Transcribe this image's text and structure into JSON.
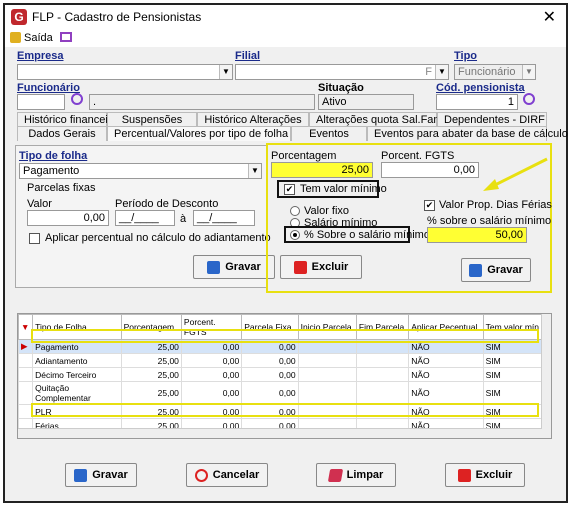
{
  "window": {
    "title": "FLP - Cadastro de Pensionistas",
    "logo": "G"
  },
  "menu": {
    "exit_label": "Saída"
  },
  "fields": {
    "empresa": {
      "label": "Empresa",
      "value": ""
    },
    "filial": {
      "label": "Filial",
      "value": "",
      "suffix": "F"
    },
    "tipo": {
      "label": "Tipo",
      "value": "Funcionário"
    },
    "funcionario": {
      "label": "Funcionário",
      "value": "",
      "name": "."
    },
    "situacao": {
      "label": "Situação",
      "value": "Ativo"
    },
    "cod_pensionista": {
      "label": "Cód. pensionista",
      "value": "1"
    }
  },
  "tabs_top": [
    "Histórico financeiro",
    "Suspensões",
    "Histórico Alterações",
    "Alterações quota Sal.Fam.",
    "Dependentes - DIRF"
  ],
  "tabs_bottom": [
    "Dados Gerais",
    "Percentual/Valores por tipo de folha",
    "Eventos",
    "Eventos para abater da base de cálculo"
  ],
  "left_panel": {
    "tipo_folha_label": "Tipo de folha",
    "tipo_folha_value": "Pagamento",
    "parcelas_label": "Parcelas fixas",
    "valor_label": "Valor",
    "valor_value": "0,00",
    "periodo_label": "Período de Desconto",
    "periodo_from": "__/____",
    "periodo_a": "à",
    "periodo_to": "__/____",
    "aplicar_label": "Aplicar percentual no cálculo do adiantamento",
    "gravar": "Gravar",
    "excluir": "Excluir"
  },
  "right_panel": {
    "porcentagem_label": "Porcentagem",
    "porcentagem_value": "25,00",
    "fgts_label": "Porcent. FGTS",
    "fgts_value": "0,00",
    "tem_valor_label": "Tem valor mínimo",
    "valor_fixo": "Valor fixo",
    "salario_minimo": "Salário mínimo",
    "sobre_salario": "% Sobre o salário mínimo",
    "prop_dias_label": "Valor Prop. Dias Férias",
    "pct_sobre_label": "% sobre o salário mínimo",
    "pct_sobre_value": "50,00",
    "gravar": "Gravar"
  },
  "grid": {
    "columns": [
      "Tipo de Folha",
      "Porcentagem",
      "Porcent. FGTS",
      "Parcela Fixa",
      "Inicio Parcela",
      "Fim Parcela",
      "Aplicar Pecentual",
      "Tem valor mín"
    ],
    "rows": [
      [
        "Pagamento",
        "25,00",
        "0,00",
        "0,00",
        "",
        "",
        "NÃO",
        "SIM"
      ],
      [
        "Adiantamento",
        "25,00",
        "0,00",
        "0,00",
        "",
        "",
        "NÃO",
        "SIM"
      ],
      [
        "Décimo Terceiro",
        "25,00",
        "0,00",
        "0,00",
        "",
        "",
        "NÃO",
        "SIM"
      ],
      [
        "Quitação Complementar",
        "25,00",
        "0,00",
        "0,00",
        "",
        "",
        "NÃO",
        "SIM"
      ],
      [
        "PLR",
        "25,00",
        "0,00",
        "0,00",
        "",
        "",
        "NÃO",
        "SIM"
      ],
      [
        "Férias",
        "25,00",
        "0,00",
        "0,00",
        "",
        "",
        "NÃO",
        "SIM"
      ]
    ]
  },
  "footer": {
    "gravar": "Gravar",
    "cancelar": "Cancelar",
    "limpar": "Limpar",
    "excluir": "Excluir"
  },
  "colors": {
    "highlight_yellow": "#ffff33",
    "annotation_yellow": "#e8e010",
    "label_blue": "#1a2a8a"
  }
}
